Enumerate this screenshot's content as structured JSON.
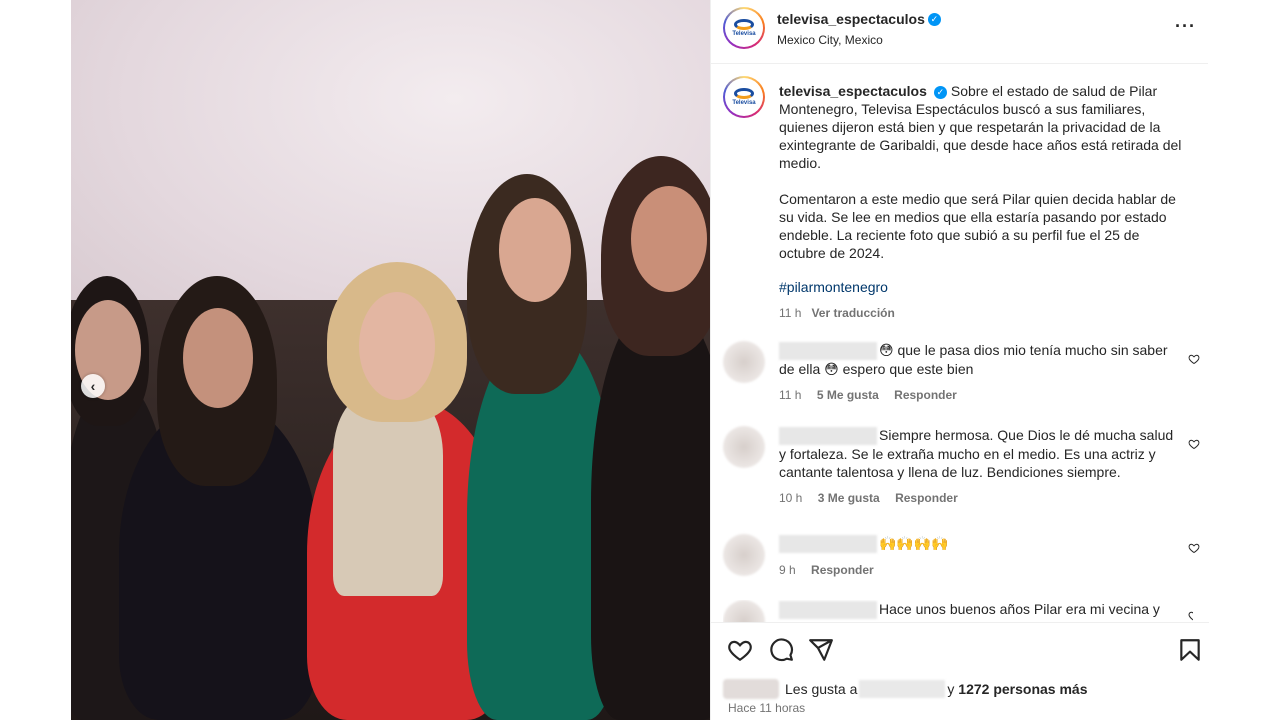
{
  "account": {
    "username": "televisa_espectaculos",
    "location": "Mexico City, Mexico",
    "logo_text": "Televisa"
  },
  "caption": {
    "paragraph1": "Sobre el estado de salud de Pilar Montenegro, Televisa Espectáculos buscó a sus familiares, quienes dijeron está bien y que respetarán la privacidad de la exintegrante de Garibaldi, que desde hace años está retirada del medio.",
    "paragraph2": "Comentaron a este medio que será Pilar quien decida hablar de su vida. Se lee en medios que ella estaría pasando por estado endeble. La reciente foto que subió a su perfil fue el 25 de octubre de 2024.",
    "hashtag": "#pilarmontenegro",
    "time": "11 h",
    "translate": "Ver traducción"
  },
  "comments": [
    {
      "text": "😳 que le pasa dios mio tenía mucho sin saber de ella 😳 espero que este bien",
      "time": "11 h",
      "likes": "5 Me gusta",
      "reply": "Responder"
    },
    {
      "text": "Siempre hermosa. Que Dios le dé mucha salud y fortaleza. Se le extraña mucho en el medio. Es una actriz y cantante talentosa y llena de luz. Bendiciones siempre.",
      "time": "10 h",
      "likes": "3 Me gusta",
      "reply": "Responder"
    },
    {
      "text": "🙌🙌🙌🙌",
      "time": "9 h",
      "likes": "",
      "reply": "Responder"
    },
    {
      "text": "Hace unos buenos años Pilar era mi vecina y",
      "time": "",
      "likes": "",
      "reply": ""
    }
  ],
  "likes": {
    "prefix": "Les gusta a",
    "suffix_y": "y",
    "count_text": "1272 personas más"
  },
  "posted": "Hace 11 horas",
  "icons": [
    "heart-icon",
    "comment-icon",
    "share-icon",
    "bookmark-icon",
    "more-icon",
    "verified-icon",
    "chevron-left-icon"
  ]
}
